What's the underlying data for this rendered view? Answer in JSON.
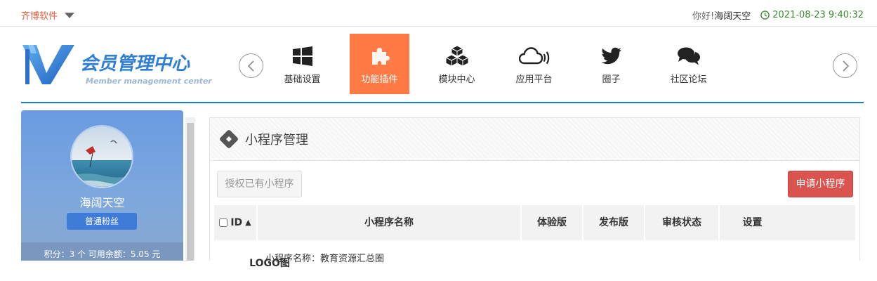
{
  "topbar": {
    "brand": "齐博软件",
    "greeting": "你好!",
    "username": "海阔天空",
    "datetime": "2021-08-23 9:40:32"
  },
  "logo": {
    "title": "会员管理中心",
    "subtitle": "Member management center"
  },
  "nav": {
    "items": [
      {
        "label": "基础设置",
        "icon": "windows-icon"
      },
      {
        "label": "功能插件",
        "icon": "puzzle-icon",
        "active": true
      },
      {
        "label": "模块中心",
        "icon": "cubes-icon"
      },
      {
        "label": "应用平台",
        "icon": "cloud-icon"
      },
      {
        "label": "圈子",
        "icon": "twitter-icon"
      },
      {
        "label": "社区论坛",
        "icon": "comments-icon"
      }
    ]
  },
  "sidebar": {
    "name": "海阔天空",
    "badge": "普通粉丝",
    "stats": "积分：3 个  可用余额：5.05 元"
  },
  "panel": {
    "title": "小程序管理",
    "auth_button": "授权已有小程序",
    "apply_button": "申请小程序",
    "columns": [
      "ID",
      "小程序名称",
      "LOGO图",
      "体验版",
      "发布版",
      "审核状态",
      "设置"
    ],
    "rows": [
      {
        "name_line": "小程序名称：教育资源汇总圈"
      }
    ]
  },
  "colors": {
    "accent": "#ff7a45",
    "primary_blue": "#1e7cc7",
    "danger": "#d9534f",
    "time_green": "#3a8a2e"
  }
}
